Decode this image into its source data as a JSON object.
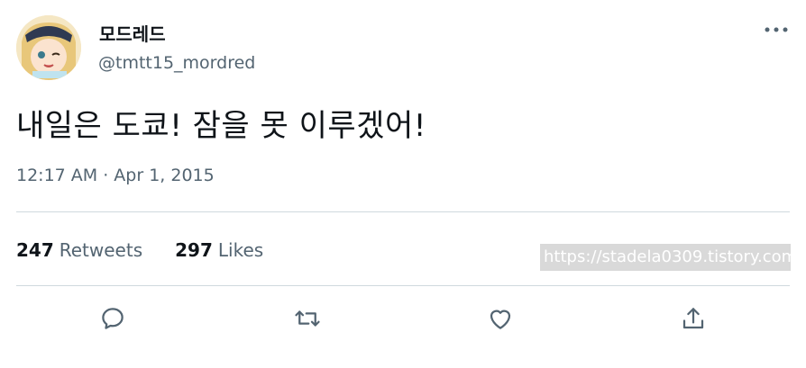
{
  "user": {
    "display_name": "모드레드",
    "handle": "@tmtt15_mordred"
  },
  "tweet": {
    "text": "내일은 도쿄! 잠을 못 이루겠어!",
    "timestamp": "12:17 AM · Apr 1, 2015"
  },
  "stats": {
    "retweets_count": "247",
    "retweets_label": "Retweets",
    "likes_count": "297",
    "likes_label": "Likes"
  },
  "watermark": "https://stadela0309.tistory.com",
  "actions": [
    "reply-icon",
    "retweet-icon",
    "like-icon",
    "share-icon"
  ],
  "colors": {
    "text_primary": "#0f1419",
    "text_secondary": "#536471",
    "divider": "#cfd9de"
  }
}
